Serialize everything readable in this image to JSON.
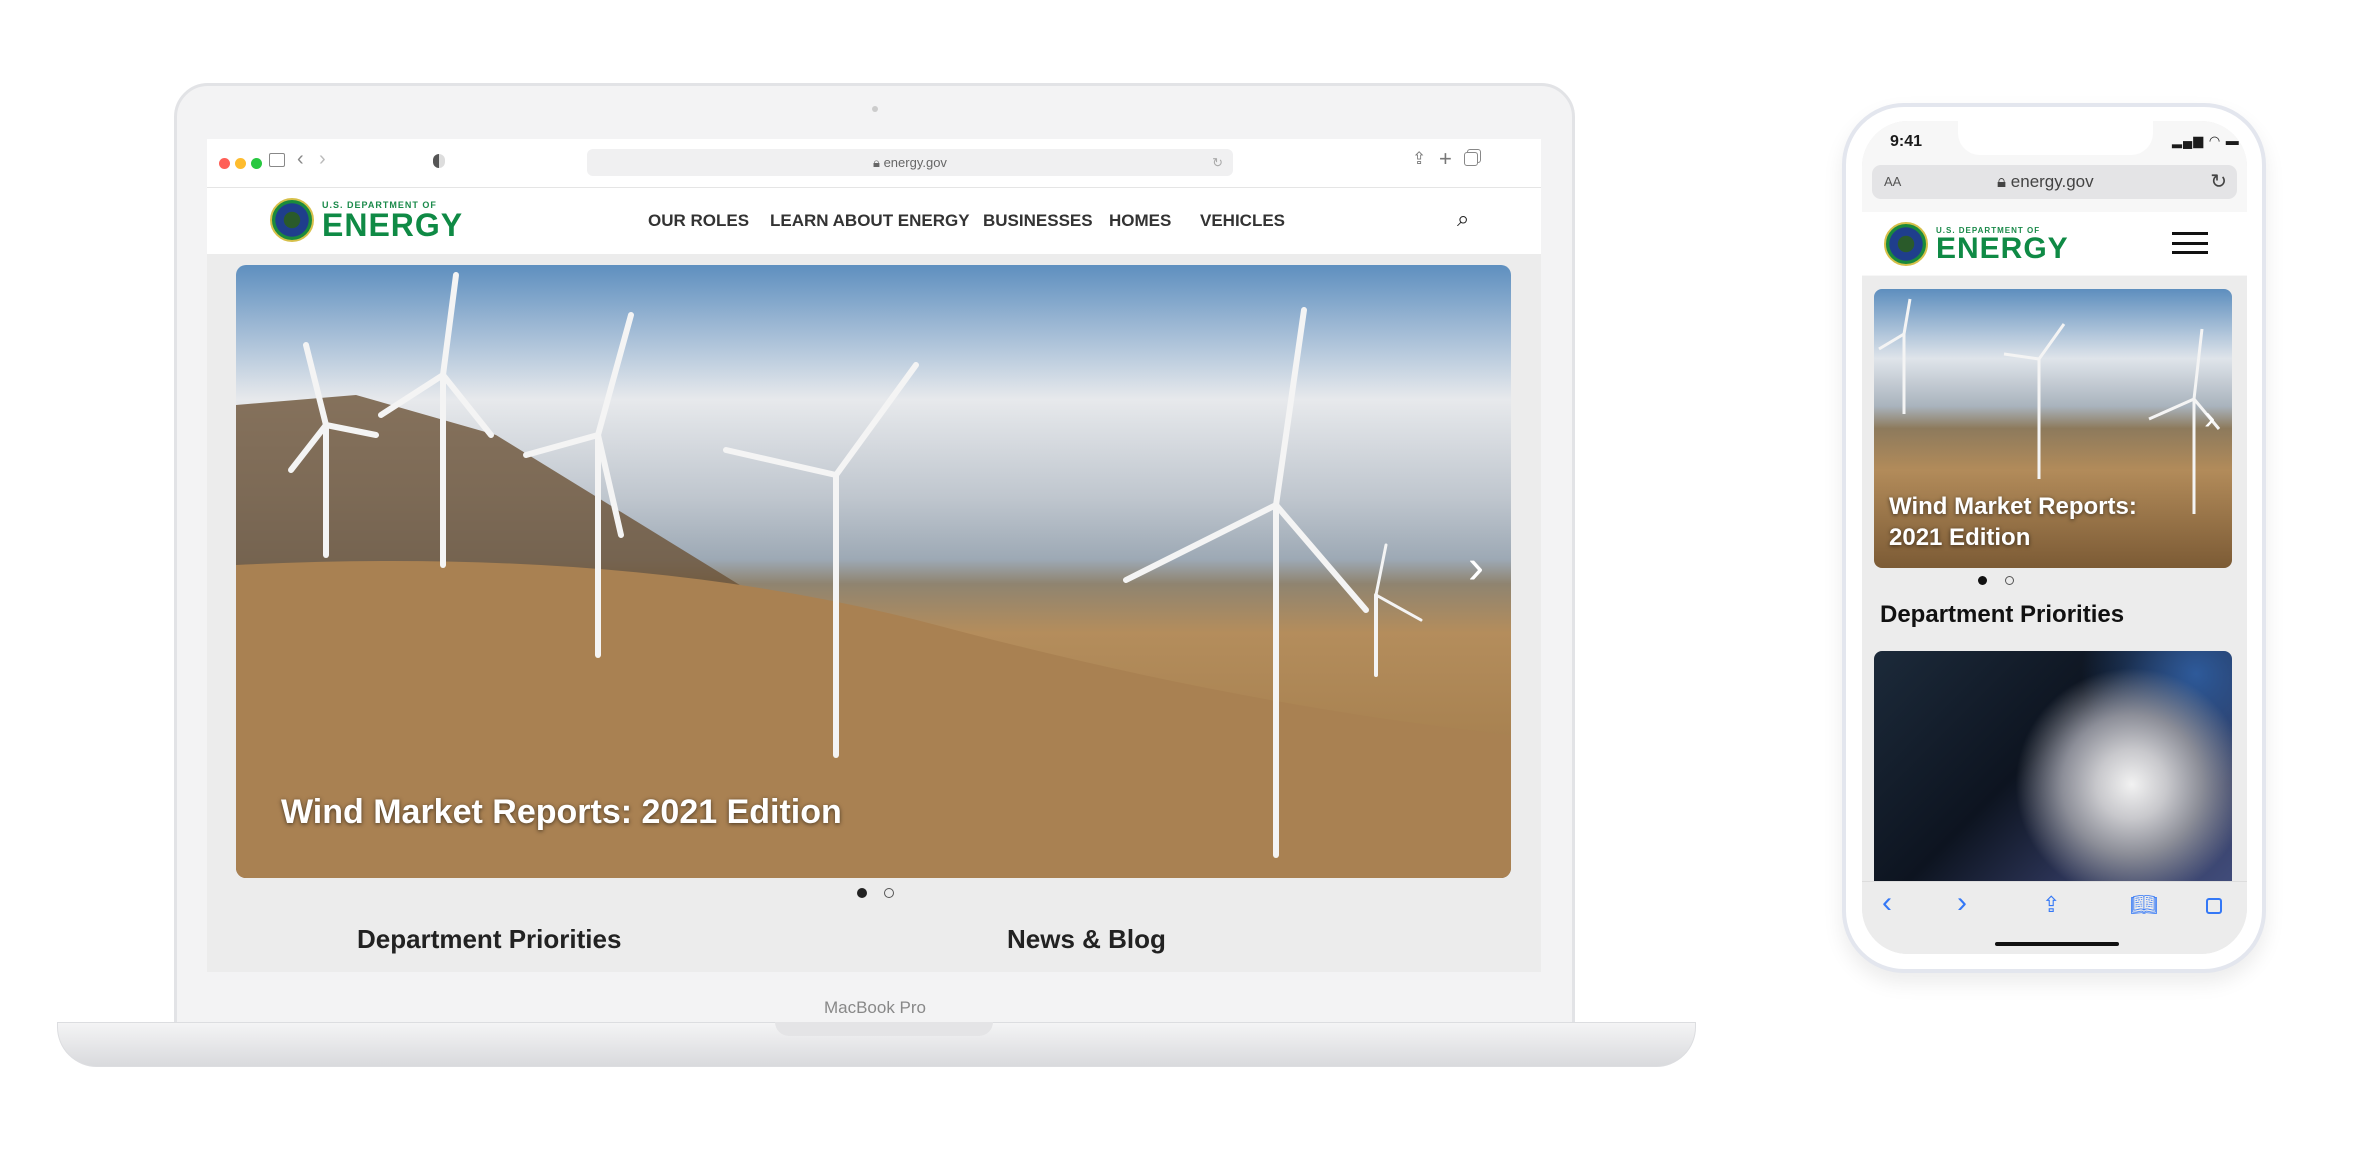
{
  "laptop": {
    "model_label": "MacBook Pro",
    "browser": {
      "url": "energy.gov"
    },
    "site": {
      "logo_small": "U.S. DEPARTMENT OF",
      "logo_big": "ENERGY",
      "nav": [
        "OUR ROLES",
        "LEARN ABOUT ENERGY",
        "BUSINESSES",
        "HOMES",
        "VEHICLES"
      ],
      "hero_title": "Wind Market Reports: 2021 Edition",
      "sections": [
        "Department Priorities",
        "News & Blog"
      ]
    }
  },
  "phone": {
    "time": "9:41",
    "text_size_label": "AA",
    "url": "energy.gov",
    "site": {
      "logo_small": "U.S. DEPARTMENT OF",
      "logo_big": "ENERGY",
      "hero_title": "Wind Market Reports: 2021 Edition",
      "section": "Department Priorities"
    }
  },
  "colors": {
    "brand_green": "#0f8a45",
    "ios_blue": "#3478f6"
  }
}
